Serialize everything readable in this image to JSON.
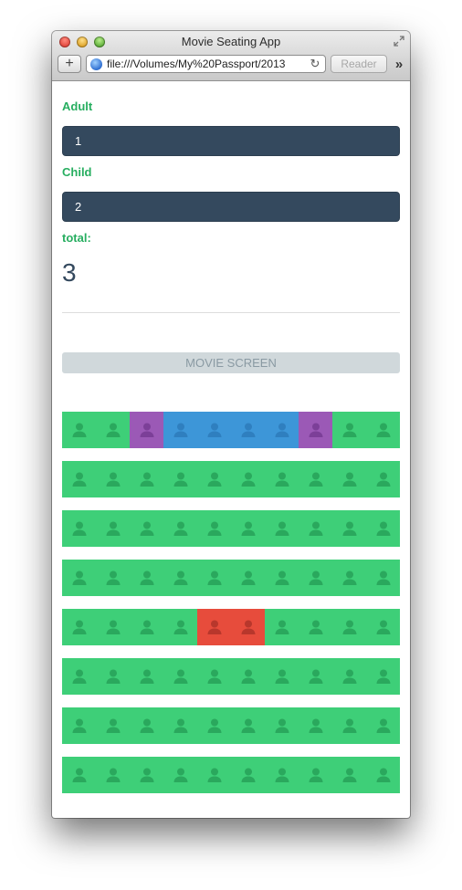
{
  "window": {
    "title": "Movie Seating App",
    "url": "file:///Volumes/My%20Passport/2013",
    "reader_label": "Reader",
    "add_label": "+",
    "reload_label": "↻",
    "overflow_label": "»"
  },
  "form": {
    "adult_label": "Adult",
    "adult_value": "1",
    "child_label": "Child",
    "child_value": "2",
    "total_label": "total:",
    "total_value": "3"
  },
  "screen_label": "MOVIE SCREEN",
  "seat_colors": {
    "available": "#3ecf78",
    "available_icon": "#2aa85d",
    "selected": "#3d96d8",
    "selected_icon": "#2f7fbf",
    "purple": "#9b59b6",
    "purple_icon": "#7c3f98",
    "taken": "#e74c3c",
    "taken_icon": "#b8372c"
  },
  "seat_rows": [
    [
      "available",
      "available",
      "purple",
      "selected",
      "selected",
      "selected",
      "selected",
      "purple",
      "available",
      "available"
    ],
    [
      "available",
      "available",
      "available",
      "available",
      "available",
      "available",
      "available",
      "available",
      "available",
      "available"
    ],
    [
      "available",
      "available",
      "available",
      "available",
      "available",
      "available",
      "available",
      "available",
      "available",
      "available"
    ],
    [
      "available",
      "available",
      "available",
      "available",
      "available",
      "available",
      "available",
      "available",
      "available",
      "available"
    ],
    [
      "available",
      "available",
      "available",
      "available",
      "taken",
      "taken",
      "available",
      "available",
      "available",
      "available"
    ],
    [
      "available",
      "available",
      "available",
      "available",
      "available",
      "available",
      "available",
      "available",
      "available",
      "available"
    ],
    [
      "available",
      "available",
      "available",
      "available",
      "available",
      "available",
      "available",
      "available",
      "available",
      "available"
    ],
    [
      "available",
      "available",
      "available",
      "available",
      "available",
      "available",
      "available",
      "available",
      "available",
      "available"
    ]
  ]
}
